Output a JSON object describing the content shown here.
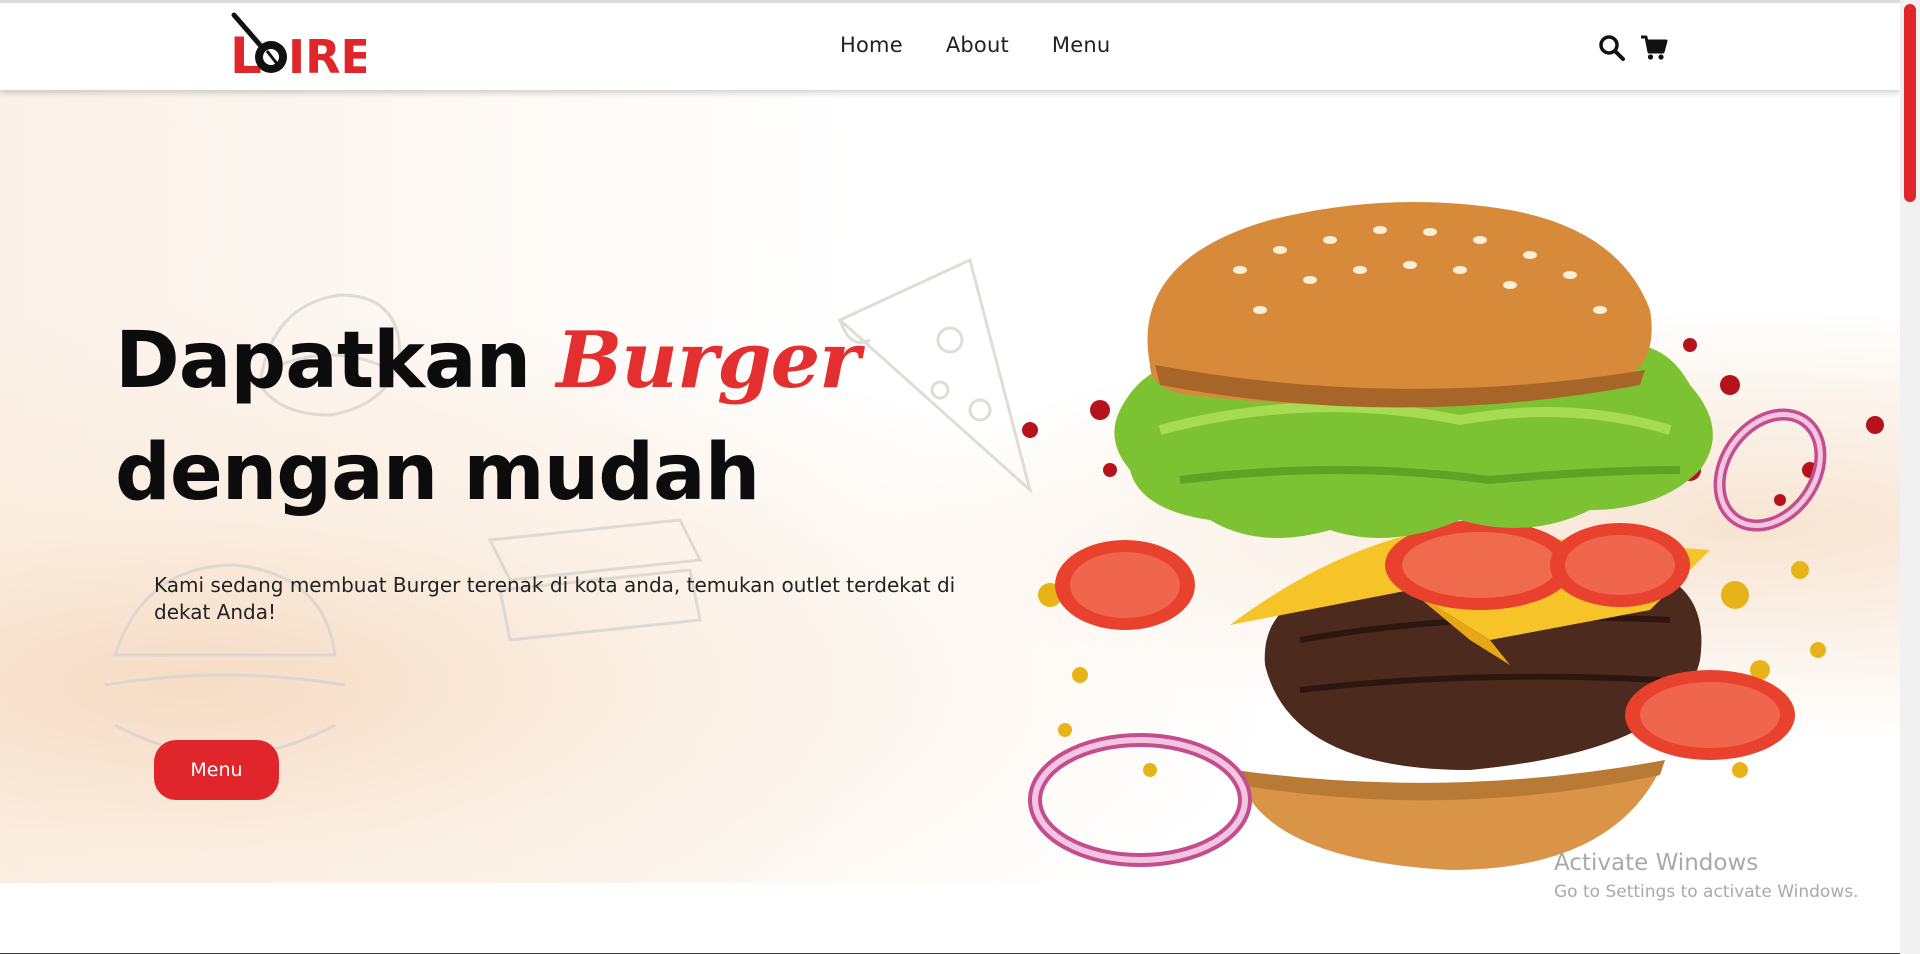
{
  "brand": {
    "logo_text": "LOIRE",
    "accent_color": "#e0252b"
  },
  "nav": {
    "links": [
      {
        "label": "Home"
      },
      {
        "label": "About"
      },
      {
        "label": "Menu"
      }
    ],
    "icons": [
      "search-icon",
      "cart-icon"
    ]
  },
  "hero": {
    "title_part1": "Dapatkan",
    "title_accent": "Burger",
    "title_part2": "dengan mudah",
    "description": "Kami sedang membuat Burger terenak di kota anda, temukan outlet terdekat di dekat Anda!",
    "cta_label": "Menu"
  },
  "watermark": {
    "line1": "Activate Windows",
    "line2": "Go to Settings to activate Windows."
  }
}
